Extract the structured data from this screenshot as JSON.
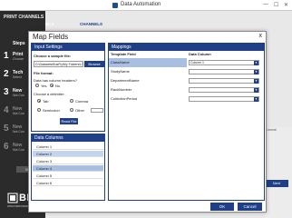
{
  "window": {
    "title": "Data Automation",
    "controls": [
      "—",
      "☐",
      "✕"
    ]
  },
  "sidebar": {
    "section_label": "PRINT CHANNELS",
    "steps_title": "Steps",
    "steps": [
      {
        "num": "1",
        "label": "Print",
        "sub": "Choose"
      },
      {
        "num": "2",
        "label": "Tech",
        "sub": "Select"
      },
      {
        "num": "3",
        "label": "New",
        "sub": "Not Con"
      },
      {
        "num": "4",
        "label": "New",
        "sub": "Not Con"
      },
      {
        "num": "5",
        "label": "New",
        "sub": "Not Con"
      },
      {
        "num": "6",
        "label": "New",
        "sub": "Not Con"
      }
    ],
    "start_button": "Start"
  },
  "background_tabs": [
    {
      "label": "PRINT CHANNELS",
      "color": "#ffffff"
    },
    {
      "label": "CHANNELS",
      "color": "#1f3f87"
    }
  ],
  "background_fragments": {
    "right_text": "Format",
    "right_button": "Next"
  },
  "brand": {
    "logo": "BRADY",
    "tagline": "WHEN PERFORMANCE MATTERS MOST"
  },
  "dialog": {
    "title": "Map Fields",
    "close": "x",
    "input_settings": {
      "header": "Input Settings",
      "choose_file_label": "Choose a sample file:",
      "file_path": "D:\\Datasets\\BusFly\\My Folders\\LT...",
      "browse": "Browse",
      "file_format_label": "File format:",
      "header_question": "Data has column headers?",
      "yes": "Yes",
      "no": "No",
      "delimiter_label": "Choose a delimiter:",
      "delimiters": [
        "Tab",
        "Comma",
        "Semicolon",
        "Other"
      ],
      "read_file": "Read File"
    },
    "data_columns": {
      "header": "Data Columns",
      "items": [
        "Column 1",
        "Column 2",
        "Column 3",
        "Column 4",
        "Column 5",
        "Column 6"
      ]
    },
    "mappings": {
      "header": "Mappings",
      "col_template": "Template Field",
      "col_data": "Data Column",
      "rows": [
        {
          "field": "ClassName",
          "value": "Column 1"
        },
        {
          "field": "StudyName",
          "value": ""
        },
        {
          "field": "DepartmentName",
          "value": ""
        },
        {
          "field": "RackNumber",
          "value": ""
        },
        {
          "field": "CollectionPeriod",
          "value": ""
        }
      ]
    },
    "ok": "OK",
    "cancel": "Cancel"
  },
  "colors": {
    "accent": "#1f3f87",
    "selection": "#c4d4ec",
    "sidebar_bg": "#2b2b2b"
  }
}
